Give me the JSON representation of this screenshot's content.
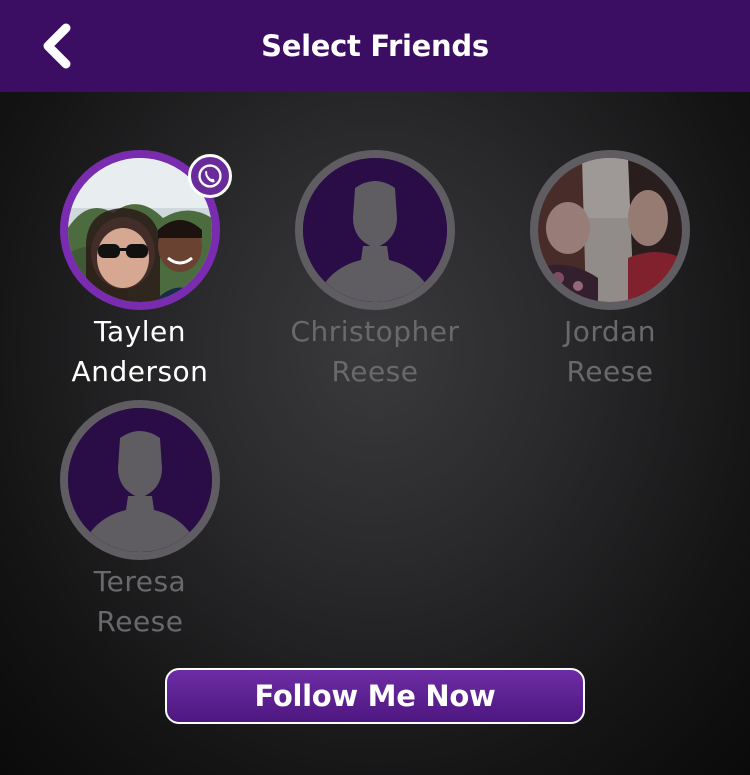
{
  "header": {
    "title": "Select Friends",
    "back_icon": "chevron-left-icon"
  },
  "friends": [
    {
      "first": "Taylen",
      "last": "Anderson",
      "selected": true,
      "avatar": "photo",
      "badge_icon": "viber-phone-icon"
    },
    {
      "first": "Christopher",
      "last": "Reese",
      "selected": false,
      "avatar": "placeholder-silhouette"
    },
    {
      "first": "Jordan",
      "last": "Reese",
      "selected": false,
      "avatar": "photo"
    },
    {
      "first": "Teresa",
      "last": "Reese",
      "selected": false,
      "avatar": "placeholder-silhouette"
    }
  ],
  "follow_button": {
    "label": "Follow Me Now"
  },
  "colors": {
    "header_bg": "#3b0e63",
    "accent_purple": "#7a2cb0",
    "inactive_text": "#6a686c",
    "ring_gray": "#5f5d62"
  }
}
